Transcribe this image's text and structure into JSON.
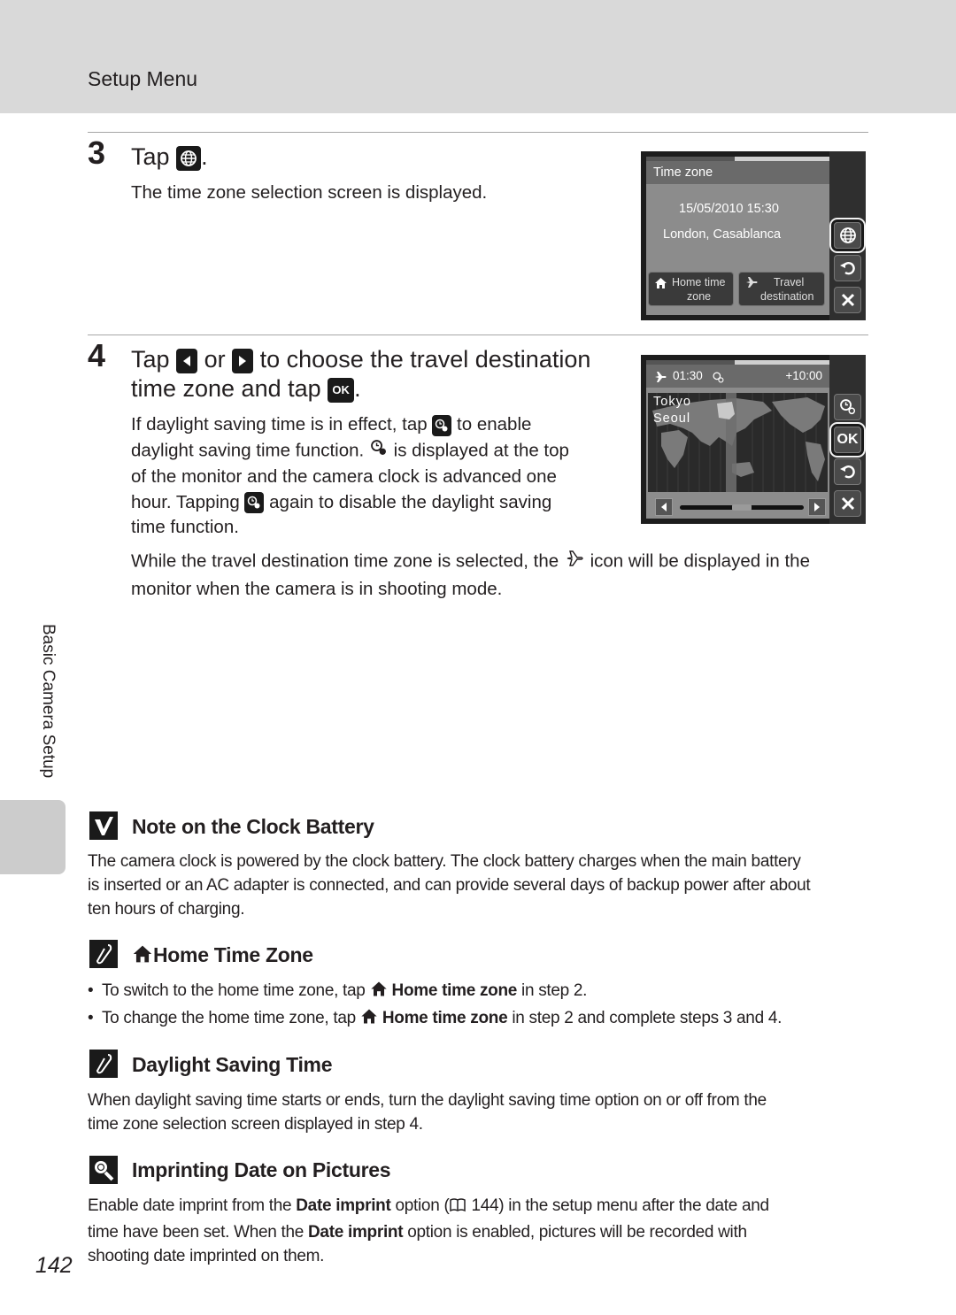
{
  "header": {
    "section_title": "Setup Menu"
  },
  "side_label": "Basic Camera Setup",
  "page_number": "142",
  "step3": {
    "number": "3",
    "title_prefix": "Tap",
    "title_icon": "globe-icon",
    "title_suffix": ".",
    "description": "The time zone selection screen is displayed.",
    "screen": {
      "header": "Time zone",
      "datetime": "15/05/2010 15:30",
      "city": "London, Casablanca",
      "home_button": {
        "icon": "home-icon",
        "line1": "Home time",
        "line2": "zone"
      },
      "travel_button": {
        "icon": "airplane-icon",
        "line1": "Travel",
        "line2": "destination"
      },
      "side_buttons": [
        "globe-icon",
        "undo-icon",
        "close-icon"
      ],
      "selected_side_button": "globe-icon"
    }
  },
  "step4": {
    "number": "4",
    "title_part1": "Tap",
    "title_icon_left": "left-arrow-icon",
    "title_or": "or",
    "title_icon_right": "right-arrow-icon",
    "title_part2": "to choose the travel destination",
    "title_line2": "time zone and tap",
    "title_icon_ok": "ok-icon",
    "title_end": ".",
    "para_lines": [
      {
        "before": "If daylight saving time is in effect, tap",
        "icon": "dst-icon",
        "after": "to enable"
      },
      {
        "before": "daylight saving time function.",
        "icon": "dst-indicator-icon",
        "after": "is displayed at the top"
      },
      {
        "before": "of the monitor and the camera clock is advanced one",
        "icon": "",
        "after": ""
      },
      {
        "before": "hour. Tapping",
        "icon": "dst-icon",
        "after": "again to disable the daylight saving"
      },
      {
        "before": "time function.",
        "icon": "",
        "after": ""
      }
    ],
    "travel_note_line1_before": "While the travel destination time zone is selected, the",
    "travel_note_line1_after": "icon will be displayed in the",
    "travel_note_line2": "monitor when the camera is in shooting mode.",
    "screen": {
      "time": "01:30",
      "offset": "+10:00",
      "cities": [
        "Tokyo",
        "Seoul"
      ],
      "side_buttons": [
        "dst-icon",
        "ok-icon",
        "undo-icon",
        "close-icon"
      ],
      "ok_label": "OK",
      "selected_side_button": "ok-icon",
      "slider_position": 0.5
    }
  },
  "notes": [
    {
      "icon": "check-icon",
      "title": "Note on the Clock Battery",
      "lines": [
        "The camera clock is powered by the clock battery. The clock battery charges when the main battery",
        "is inserted or an AC adapter is connected, and can provide several days of backup power after about",
        "ten hours of charging."
      ]
    },
    {
      "icon": "pencil-icon",
      "title": "Home Time Zone",
      "bullets": [
        {
          "before": "To switch to the home time zone, tap",
          "bold": "Home time zone",
          "after": "in step 2."
        },
        {
          "before": "To change the home time zone, tap",
          "bold": "Home time zone",
          "after": "in step 2 and complete steps 3 and 4."
        }
      ]
    },
    {
      "icon": "pencil-icon",
      "title": "Daylight Saving Time",
      "lines": [
        "When daylight saving time starts or ends, turn the daylight saving time option on or off from the",
        "time zone selection screen displayed in step 4."
      ]
    },
    {
      "icon": "date-imprint-icon",
      "title": "Imprinting Date on Pictures",
      "line1_before": "Enable date imprint from the",
      "line1_bold": "Date imprint",
      "line1_mid": "option (",
      "line1_ref_icon": "book-icon",
      "line1_ref": "144) in the setup menu after the date and",
      "line2_before": "time have been set. When the",
      "line2_bold": "Date imprint",
      "line2_after": "option is enabled, pictures will be recorded with",
      "line3": "shooting date imprinted on them."
    }
  ]
}
